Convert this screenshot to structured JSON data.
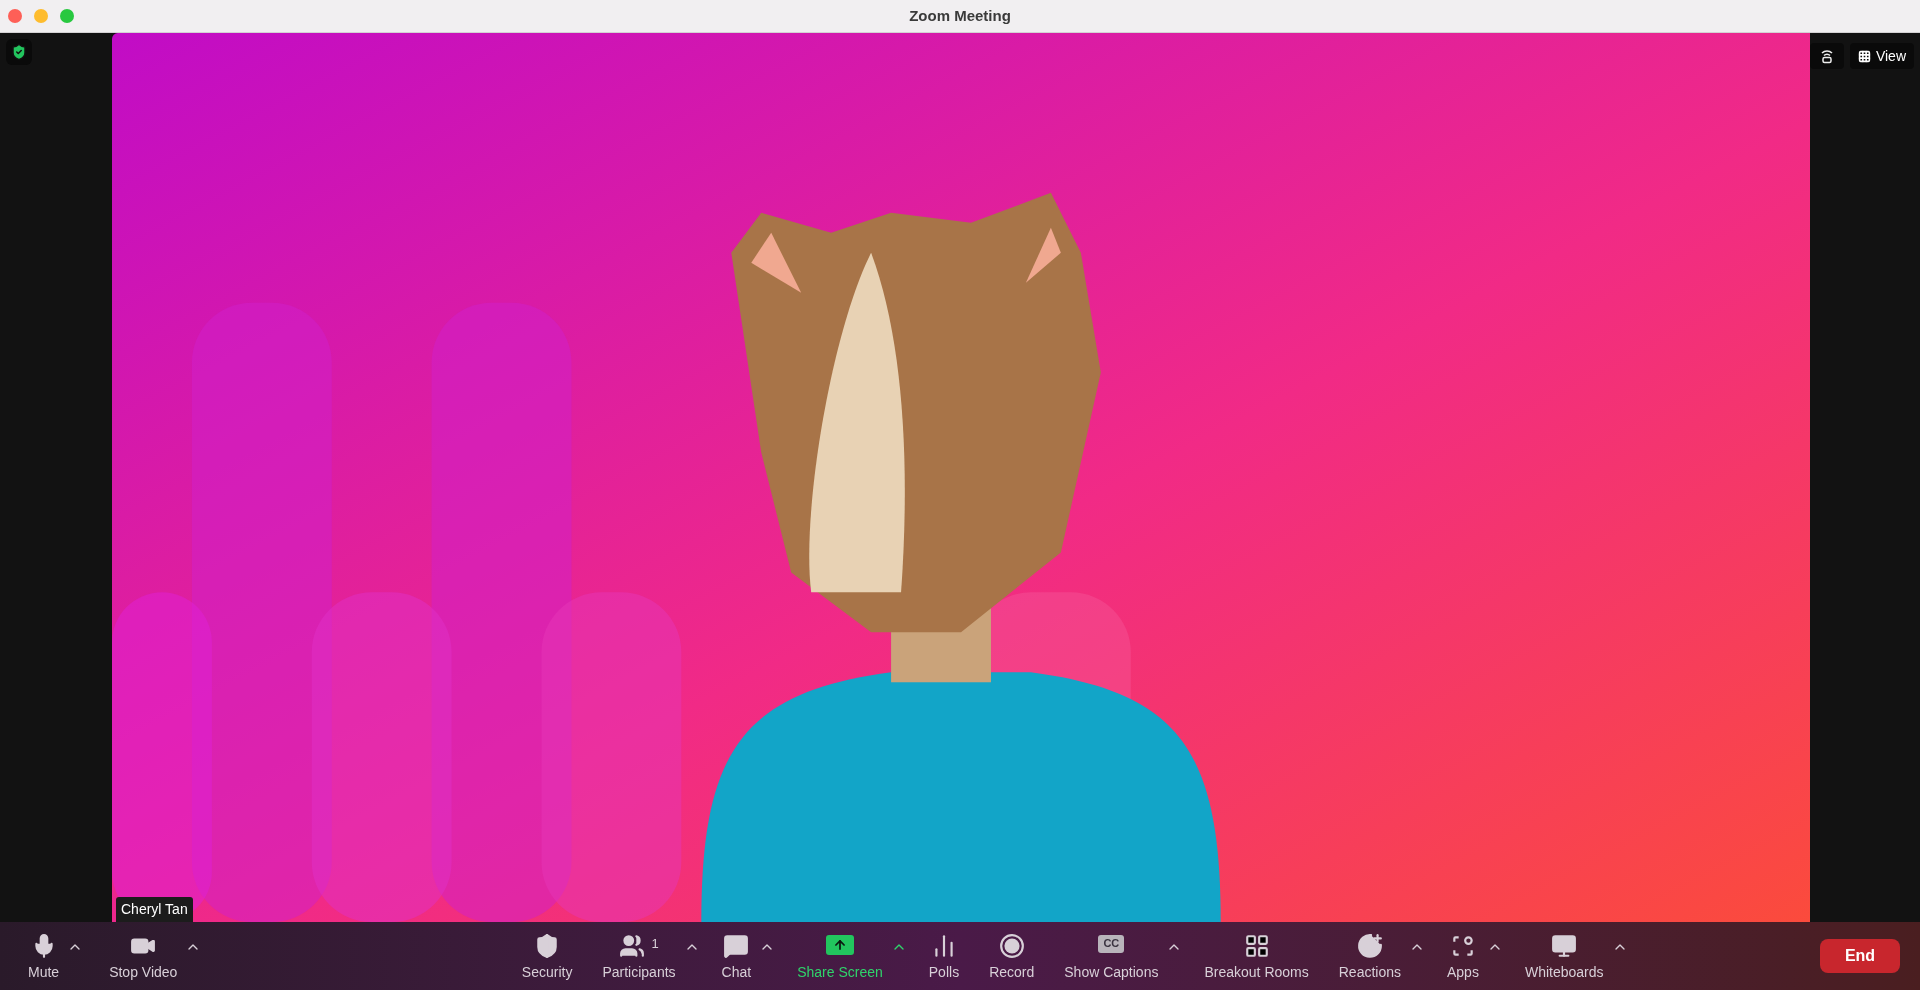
{
  "window": {
    "title": "Zoom Meeting"
  },
  "video": {
    "kind": "picture",
    "participant_name": "Cheryl Tan"
  },
  "view_button": {
    "label": "View"
  },
  "toolbar": {
    "left": [
      {
        "label": "Mute",
        "has_menu": true,
        "active": false
      },
      {
        "label": "Stop Video",
        "has_menu": true,
        "active": false
      }
    ],
    "center": [
      {
        "label": "Security",
        "has_menu": false,
        "active": false
      },
      {
        "label": "Participants",
        "count": "1",
        "has_menu": true,
        "active": false
      },
      {
        "label": "Chat",
        "has_menu": true,
        "active": false
      },
      {
        "label": "Share Screen",
        "has_menu": true,
        "active": true
      },
      {
        "label": "Polls",
        "has_menu": false,
        "active": false
      },
      {
        "label": "Record",
        "has_menu": false,
        "active": false
      },
      {
        "label": "Show Captions",
        "badge": "CC",
        "has_menu": true,
        "active": false
      },
      {
        "label": "Breakout Rooms",
        "has_menu": false,
        "active": false
      },
      {
        "label": "Reactions",
        "has_menu": true,
        "active": false
      },
      {
        "label": "Apps",
        "has_menu": true,
        "active": false
      },
      {
        "label": "Whiteboards",
        "has_menu": true,
        "active": false
      }
    ],
    "end_button": {
      "label": "End"
    }
  }
}
